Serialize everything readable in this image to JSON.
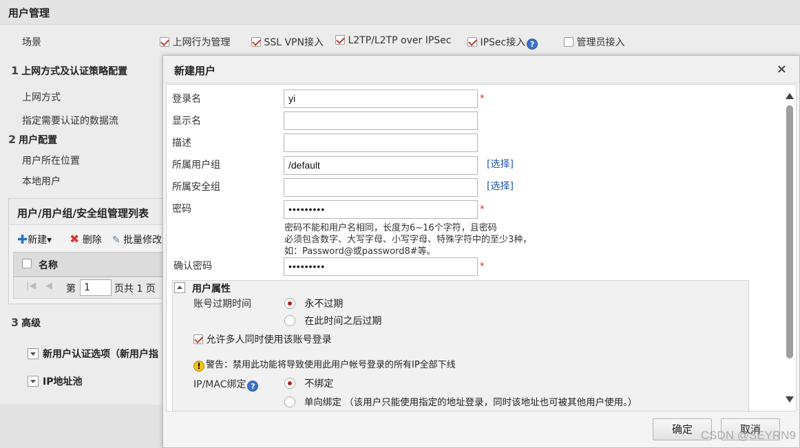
{
  "page": {
    "title": "用户管理",
    "scene_label": "场景",
    "scenes": [
      {
        "label": "上网行为管理",
        "checked": true
      },
      {
        "label": "SSL VPN接入",
        "checked": true
      },
      {
        "label": "L2TP/L2TP over IPSec",
        "checked": true
      },
      {
        "label": "IPSec接入",
        "checked": true
      },
      {
        "label": "管理员接入",
        "checked": false
      }
    ],
    "section1": {
      "num": "1",
      "title": "上网方式及认证策略配置",
      "rows": [
        "上网方式",
        "指定需要认证的数据流"
      ]
    },
    "section2": {
      "num": "2",
      "title": "用户配置",
      "rows": [
        "用户所在位置",
        "本地用户"
      ]
    },
    "list_panel": {
      "title": "用户/用户组/安全组管理列表",
      "new": "新建",
      "delete": "删除",
      "batch": "批量修改",
      "col_name": "名称",
      "pager_prefix": "第",
      "pager_value": "1",
      "pager_suffix": "页共 1 页"
    },
    "section3": {
      "num": "3",
      "title": "高级"
    },
    "advanced_items": [
      "新用户认证选项（新用户指",
      "IP地址池"
    ]
  },
  "dialog": {
    "title": "新建用户",
    "close": "×",
    "login_name": {
      "label": "登录名",
      "value": "yi"
    },
    "display_name": {
      "label": "显示名",
      "value": ""
    },
    "description": {
      "label": "描述",
      "value": ""
    },
    "user_group": {
      "label": "所属用户组",
      "value": "/default",
      "link": "[选择]"
    },
    "security_group": {
      "label": "所属安全组",
      "value": "",
      "link": "[选择]"
    },
    "password": {
      "label": "密码",
      "value": "•••••••••"
    },
    "password_hint": [
      "密码不能和用户名相同，长度为6~16个字符，且密码",
      "必须包含数字、大写字母、小写字母、特殊字符中的至少3种，",
      "如：Password@或password8#等。"
    ],
    "confirm_password": {
      "label": "确认密码",
      "value": "•••••••••"
    },
    "required_mark": "*",
    "attributes": {
      "title": "用户属性",
      "expire_label": "账号过期时间",
      "expire_options": [
        {
          "label": "永不过期",
          "selected": true
        },
        {
          "label": "在此时间之后过期",
          "selected": false
        }
      ],
      "multi_login": {
        "label": "允许多人同时使用该账号登录",
        "checked": true
      },
      "warning": "警告：禁用此功能将导致使用此用户帐号登录的所有IP全部下线",
      "ipmac_label": "IP/MAC绑定",
      "ipmac_options": [
        {
          "label": "不绑定",
          "selected": true
        },
        {
          "label": "单向绑定 （该用户只能使用指定的地址登录，同时该地址也可被其他用户使用。）",
          "selected": false
        }
      ]
    },
    "ok": "确定",
    "cancel": "取消"
  },
  "watermark": "CSDN @SEYRN9",
  "colors": {
    "accent_red": "#c0392b",
    "link_blue": "#2458b3"
  }
}
